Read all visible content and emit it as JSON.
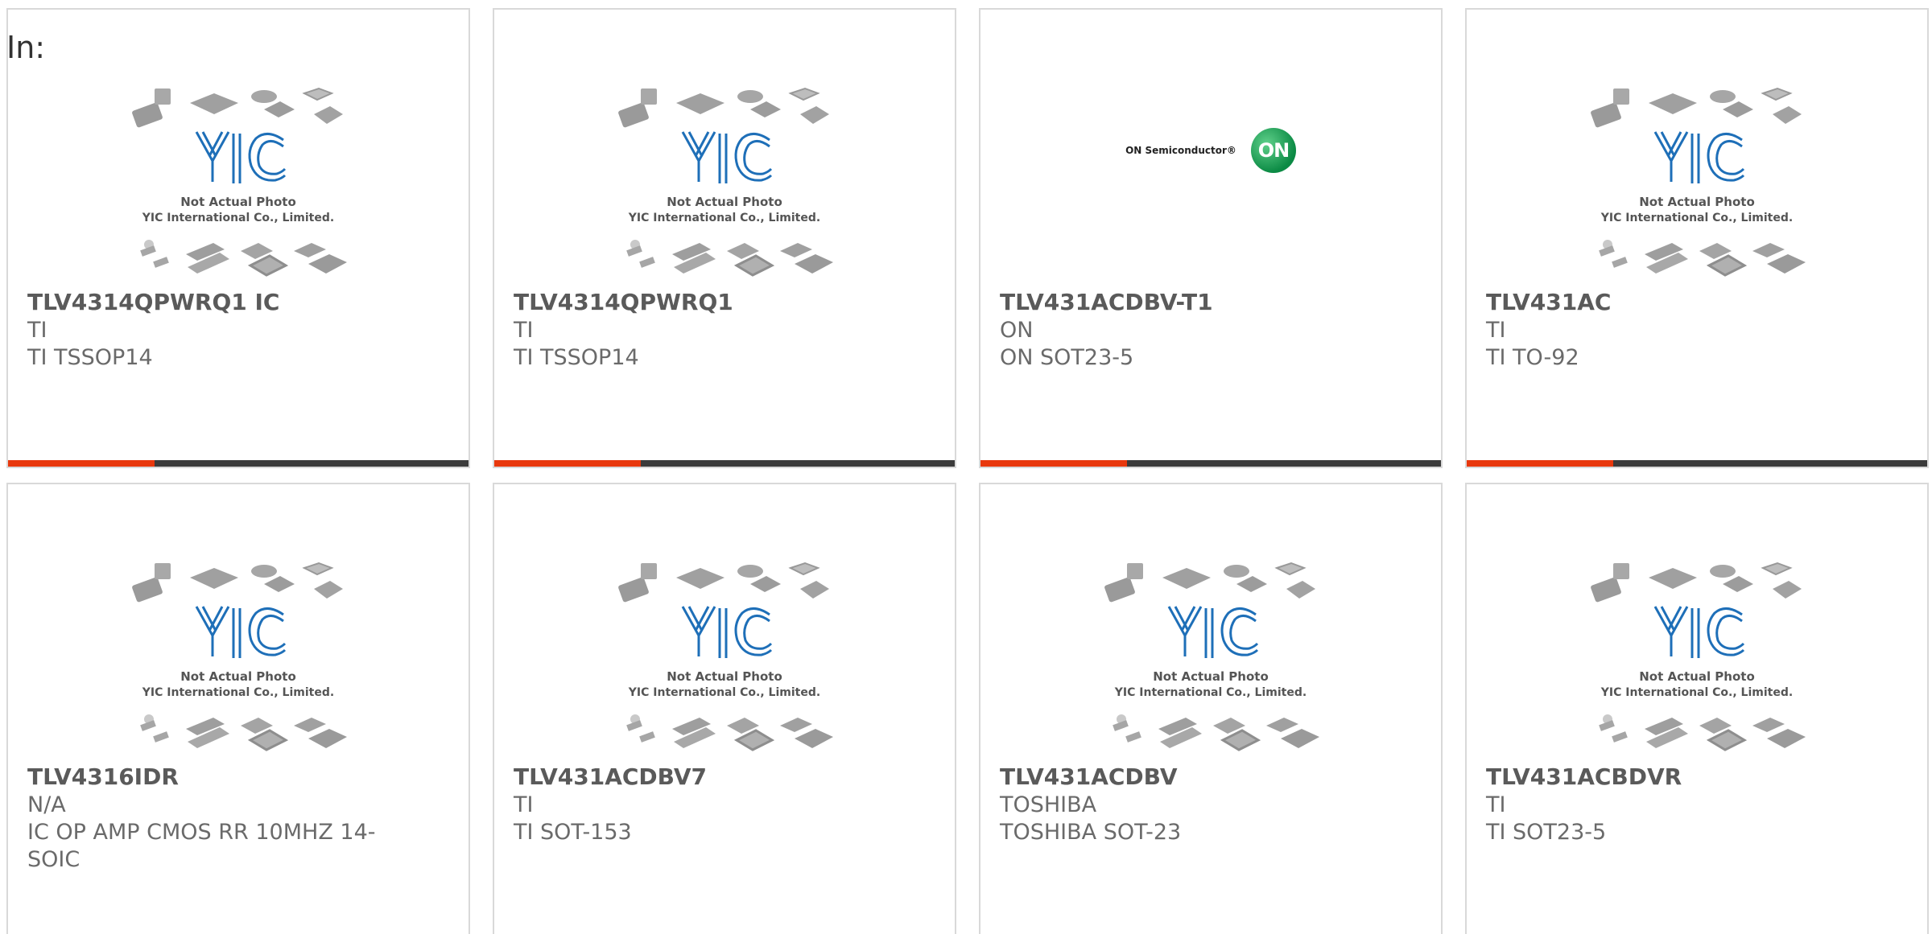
{
  "page": {
    "in_label": "In:"
  },
  "placeholder": {
    "line1": "Not Actual Photo",
    "line2": "YIC International Co., Limited.",
    "logo": "YIC",
    "accent_color": "#e8380d",
    "bar_color": "#3b3b3b",
    "logo_color": "#1e6fb8"
  },
  "on_logo": {
    "text": "ON Semiconductor®",
    "mark": "ON"
  },
  "products": [
    {
      "part": "TLV4314QPWRQ1 IC",
      "maker": "TI",
      "desc": "TI TSSOP14",
      "image": "yic-placeholder"
    },
    {
      "part": "TLV4314QPWRQ1",
      "maker": "TI",
      "desc": "TI TSSOP14",
      "image": "yic-placeholder"
    },
    {
      "part": "TLV431ACDBV-T1",
      "maker": "ON",
      "desc": "ON SOT23-5",
      "image": "on-semiconductor-logo"
    },
    {
      "part": "TLV431AC",
      "maker": "TI",
      "desc": "TI TO-92",
      "image": "yic-placeholder"
    },
    {
      "part": "TLV4316IDR",
      "maker": "N/A",
      "desc": "IC OP AMP CMOS RR 10MHZ 14-SOIC",
      "image": "yic-placeholder"
    },
    {
      "part": "TLV431ACDBV7",
      "maker": "TI",
      "desc": "TI SOT-153",
      "image": "yic-placeholder"
    },
    {
      "part": "TLV431ACDBV",
      "maker": "TOSHIBA",
      "desc": "TOSHIBA SOT-23",
      "image": "yic-placeholder"
    },
    {
      "part": "TLV431ACBDVR",
      "maker": "TI",
      "desc": "TI SOT23-5",
      "image": "yic-placeholder"
    }
  ]
}
